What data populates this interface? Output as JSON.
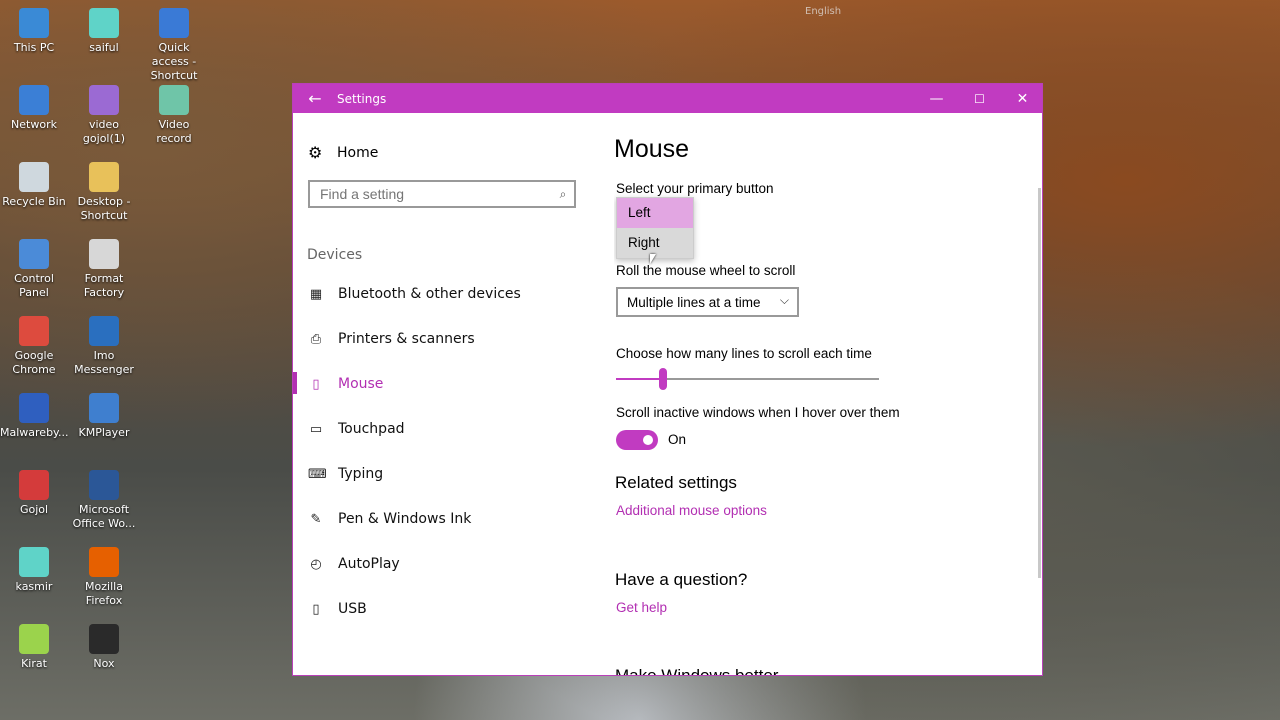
{
  "desktop": {
    "icons": [
      {
        "label": "This PC",
        "color": "#3a8ad6"
      },
      {
        "label": "saiful",
        "color": "#5fd3c8"
      },
      {
        "label": "Quick access - Shortcut",
        "color": "#3a7ad6"
      },
      {
        "label": "Network",
        "color": "#3b7fd6"
      },
      {
        "label": "video gojol(1)",
        "color": "#9b6ad3"
      },
      {
        "label": "Video record",
        "color": "#6fc5a8"
      },
      {
        "label": "Recycle Bin",
        "color": "#cfd8de"
      },
      {
        "label": "Desktop - Shortcut",
        "color": "#e8c15a"
      },
      {
        "label": "Control Panel",
        "color": "#4b8bd8"
      },
      {
        "label": "Format Factory",
        "color": "#d7d7d7"
      },
      {
        "label": "Google Chrome",
        "color": "#dd4b3e"
      },
      {
        "label": "Imo Messenger",
        "color": "#2a6fbf"
      },
      {
        "label": "Malwareby...",
        "color": "#2f5fbf"
      },
      {
        "label": "KMPlayer",
        "color": "#3f7fcf"
      },
      {
        "label": "Gojol",
        "color": "#d43b3b"
      },
      {
        "label": "Microsoft Office Wo...",
        "color": "#2b5797"
      },
      {
        "label": "kasmir",
        "color": "#5fd3c8"
      },
      {
        "label": "Mozilla Firefox",
        "color": "#e66000"
      },
      {
        "label": "Kirat",
        "color": "#9bd34c"
      },
      {
        "label": "Nox",
        "color": "#2a2a2a"
      }
    ],
    "tray_text": "English"
  },
  "window": {
    "title": "Settings",
    "back_icon": "←",
    "minimize": "—",
    "maximize": "☐",
    "close": "✕"
  },
  "sidebar": {
    "home_label": "Home",
    "search_placeholder": "Find a setting",
    "section": "Devices",
    "items": [
      {
        "label": "Bluetooth & other devices",
        "icon": "▦"
      },
      {
        "label": "Printers & scanners",
        "icon": "⎙"
      },
      {
        "label": "Mouse",
        "icon": "▯"
      },
      {
        "label": "Touchpad",
        "icon": "▭"
      },
      {
        "label": "Typing",
        "icon": "⌨"
      },
      {
        "label": "Pen & Windows Ink",
        "icon": "✎"
      },
      {
        "label": "AutoPlay",
        "icon": "◴"
      },
      {
        "label": "USB",
        "icon": "▯"
      }
    ]
  },
  "main": {
    "title": "Mouse",
    "primary_button_label": "Select your primary button",
    "primary_options": [
      "Left",
      "Right"
    ],
    "scroll_label": "Roll the mouse wheel to scroll",
    "scroll_value": "Multiple lines at a time",
    "lines_label": "Choose how many lines to scroll each time",
    "lines_fraction": 0.18,
    "inactive_label": "Scroll inactive windows when I hover over them",
    "inactive_state": "On",
    "related_title": "Related settings",
    "related_link": "Additional mouse options",
    "question_title": "Have a question?",
    "question_link": "Get help",
    "better_title": "Make Windows better"
  }
}
